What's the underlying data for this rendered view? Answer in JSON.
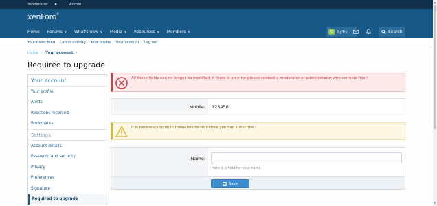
{
  "staffbar": {
    "moderator": "Moderator",
    "admin": "Admin"
  },
  "logo": {
    "text": "xenForo"
  },
  "nav": {
    "items": [
      {
        "label": "Home"
      },
      {
        "label": "Forums"
      },
      {
        "label": "What's new"
      },
      {
        "label": "Media"
      },
      {
        "label": "Resources"
      },
      {
        "label": "Members"
      }
    ],
    "user": {
      "initials": "S",
      "name": "SyTry"
    },
    "search_label": "Search"
  },
  "subnav": [
    "Your news feed",
    "Latest activity",
    "Your profile",
    "Your account",
    "Log out"
  ],
  "breadcrumb": {
    "home": "Home",
    "current": "Your account"
  },
  "page_title": "Required to upgrade",
  "sidebar": {
    "heading": "Your account",
    "items_top": [
      "Your profile",
      "Alerts",
      "Reactions received",
      "Bookmarks"
    ],
    "settings_heading": "Settings",
    "items_settings": [
      "Account details",
      "Password and security",
      "Privacy",
      "Preferences",
      "Signature",
      "Required to upgrade"
    ]
  },
  "alerts": {
    "error": "All these fields can no longer be modified, if there is an error please contact a moderator or administrator who corrects this !",
    "warning": "It is necessary to fill in these two fields before you can subscribe !"
  },
  "mobile": {
    "label": "Mobile:",
    "value": "123456"
  },
  "form": {
    "name_label": "Name:",
    "name_value": "",
    "hint": "Here is a field for your name.",
    "save_label": "Save"
  }
}
